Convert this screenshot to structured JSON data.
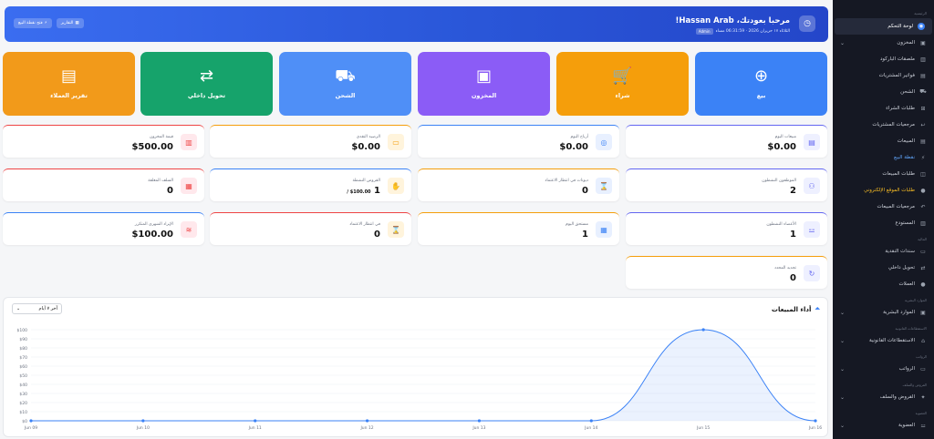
{
  "hero": {
    "title": "مرحبا بعودتك، Hassan Arab!",
    "subtitle": "الثلاثاء ١٧ حزيران 2026 · 06:31:59 مساء",
    "badge": "Admin",
    "btn_reports": "التقارير",
    "btn_pos": "فتح نقطة البيع"
  },
  "quick_actions": [
    {
      "label": "بيع",
      "icon": "plus-circle-icon",
      "color": "#3b82f6"
    },
    {
      "label": "شراء",
      "icon": "cart-plus-icon",
      "color": "#f59e0b"
    },
    {
      "label": "المخزون",
      "icon": "box-icon",
      "color": "#8b5cf6"
    },
    {
      "label": "الشحن",
      "icon": "truck-icon",
      "color": "#4f8ff7"
    },
    {
      "label": "تحويل داخلي",
      "icon": "transfer-icon",
      "color": "#16a36b"
    },
    {
      "label": "تقرير العملاء",
      "icon": "file-icon",
      "color": "#f29a1a"
    }
  ],
  "stats": [
    {
      "label": "مبيعات اليوم",
      "value": "$0.00",
      "icon": "receipt-icon"
    },
    {
      "label": "أرباح اليوم",
      "value": "$0.00",
      "icon": "coins-icon"
    },
    {
      "label": "الرصيد النقدي",
      "value": "$0.00",
      "icon": "wallet-icon"
    },
    {
      "label": "قيمة المخزون",
      "value": "$500.00",
      "icon": "warehouse-icon"
    },
    {
      "label": "الموظفون النشطون",
      "value": "2",
      "icon": "users-icon"
    },
    {
      "label": "ديونات في انتظار الاعتماد",
      "value": "0",
      "icon": "hourglass-icon"
    },
    {
      "label": "القروض النشطة",
      "value": "1",
      "sub": "$100.00 /",
      "icon": "hand-coin-icon"
    },
    {
      "label": "السلف المعلقة",
      "value": "0",
      "icon": "money-icon"
    },
    {
      "label": "الأعضاء النشطون",
      "value": "1",
      "icon": "dumbbell-icon"
    },
    {
      "label": "مستحق اليوم",
      "value": "1",
      "icon": "calendar-icon"
    },
    {
      "label": "في انتظار الاعتماد",
      "value": "0",
      "icon": "hourglass-icon"
    },
    {
      "label": "الإيراد الشهري المتكرر",
      "value": "$100.00",
      "icon": "stack-coins-icon"
    },
    {
      "label": "تجديد المحدد",
      "value": "0",
      "icon": "refresh-icon"
    }
  ],
  "chart_header": {
    "title": "أداء المبيعات",
    "range": "آخر ٧ أيام"
  },
  "chart_data": {
    "type": "area",
    "title": "أداء المبيعات",
    "x": [
      "Jun 09",
      "Jun 10",
      "Jun 11",
      "Jun 12",
      "Jun 13",
      "Jun 14",
      "Jun 15",
      "Jun 16"
    ],
    "y_ticks": [
      "$0",
      "$10",
      "$20",
      "$30",
      "$40",
      "$50",
      "$60",
      "$70",
      "$80",
      "$90",
      "$100"
    ],
    "values": [
      0,
      0,
      0,
      0,
      0,
      0,
      100,
      0
    ],
    "ylim": [
      0,
      100
    ],
    "color": "#3b82f6"
  },
  "sidebar": {
    "head": "الرئيسية",
    "items": [
      {
        "label": "لوحة التحكم",
        "icon": "dashboard-icon",
        "state": "active"
      },
      {
        "label": "المخزون",
        "icon": "box-icon",
        "chev": "⌄"
      },
      {
        "label": "ملصقات الباركود",
        "icon": "barcode-icon"
      },
      {
        "label": "فواتير المشتريات",
        "icon": "invoice-icon"
      },
      {
        "label": "الشحن",
        "icon": "truck-icon"
      },
      {
        "label": "طلبات الشراء",
        "icon": "cart-icon"
      },
      {
        "label": "مرجعيات المشتريات",
        "icon": "return-icon"
      },
      {
        "label": "المبيعات",
        "icon": "receipt-icon"
      },
      {
        "label": "نقطة البيع",
        "icon": "bolt-icon",
        "state": "blue"
      },
      {
        "label": "طلبات المبيعات",
        "icon": "bag-icon"
      },
      {
        "label": "طلبات الموقع الإلكتروني",
        "icon": "globe-icon",
        "state": "yellow"
      },
      {
        "label": "مرجعيات المبيعات",
        "icon": "undo-icon"
      },
      {
        "label": "المستودع",
        "icon": "warehouse-icon"
      },
      {
        "label": "المالية",
        "section": true
      },
      {
        "label": "سندات النقدية",
        "icon": "cash-icon"
      },
      {
        "label": "تحويل داخلي",
        "icon": "transfer-icon"
      },
      {
        "label": "العملات",
        "icon": "coin-icon"
      },
      {
        "label": "الموارد البشرية",
        "section": true
      },
      {
        "label": "الموارد البشرية",
        "icon": "id-card-icon",
        "chev": "⌄"
      },
      {
        "label": "الاستقطاعات القانونية",
        "section": true
      },
      {
        "label": "الاستقطاعات القانونية",
        "icon": "bank-icon",
        "chev": "⌄"
      },
      {
        "label": "الرواتب",
        "section": true
      },
      {
        "label": "الرواتب",
        "icon": "wallet-icon",
        "chev": "⌄"
      },
      {
        "label": "القروض والسلف",
        "section": true
      },
      {
        "label": "القروض والسلف",
        "icon": "handshake-icon",
        "chev": "⌄"
      },
      {
        "label": "العضوية",
        "section": true
      },
      {
        "label": "العضوية",
        "icon": "dumbbell-icon",
        "chev": "⌄"
      }
    ]
  }
}
